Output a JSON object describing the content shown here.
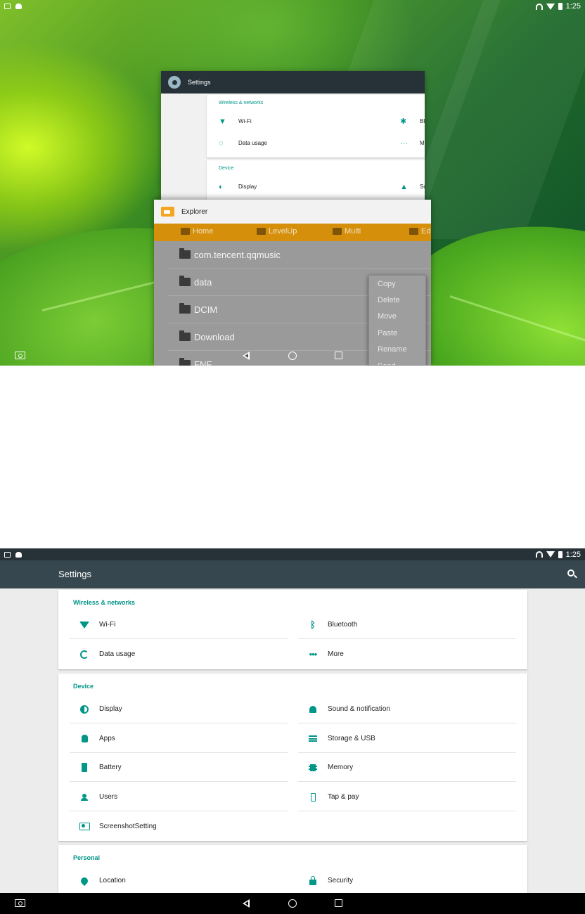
{
  "status_bar": {
    "time": "1:25"
  },
  "recents": {
    "settings_card": {
      "title": "Settings",
      "section_title": "Wireless & networks",
      "items": [
        "Wi-Fi",
        "Bl",
        "Data usage",
        "M"
      ],
      "device_title": "Device",
      "device_items": [
        "Display",
        "So"
      ]
    },
    "explorer_card": {
      "title": "Explorer",
      "toolbar": [
        "Home",
        "LevelUp",
        "Multi",
        "Ed"
      ],
      "files": [
        "com.tencent.qqmusic",
        "data",
        "DCIM",
        "Download",
        "FNF"
      ],
      "context_menu": [
        "Copy",
        "Delete",
        "Move",
        "Paste",
        "Rename",
        "Send"
      ]
    }
  },
  "settings": {
    "title": "Settings",
    "sections": [
      {
        "title": "Wireless & networks",
        "items": [
          {
            "label": "Wi-Fi",
            "icon": "wifi-icon"
          },
          {
            "label": "Bluetooth",
            "icon": "bluetooth-icon"
          },
          {
            "label": "Data usage",
            "icon": "data-usage-icon"
          },
          {
            "label": "More",
            "icon": "more-icon"
          }
        ]
      },
      {
        "title": "Device",
        "items": [
          {
            "label": "Display",
            "icon": "display-icon"
          },
          {
            "label": "Sound & notification",
            "icon": "bell-icon"
          },
          {
            "label": "Apps",
            "icon": "android-icon"
          },
          {
            "label": "Storage & USB",
            "icon": "storage-icon"
          },
          {
            "label": "Battery",
            "icon": "battery-icon"
          },
          {
            "label": "Memory",
            "icon": "memory-icon"
          },
          {
            "label": "Users",
            "icon": "user-icon"
          },
          {
            "label": "Tap & pay",
            "icon": "tap-pay-icon"
          },
          {
            "label": "ScreenshotSetting",
            "icon": "screenshot-icon"
          }
        ]
      },
      {
        "title": "Personal",
        "items": [
          {
            "label": "Location",
            "icon": "location-icon"
          },
          {
            "label": "Security",
            "icon": "lock-icon"
          }
        ]
      }
    ]
  },
  "colors": {
    "accent": "#009688",
    "appbar": "#37474f",
    "statusbar": "#263238",
    "explorer_toolbar": "#d68f0a"
  }
}
